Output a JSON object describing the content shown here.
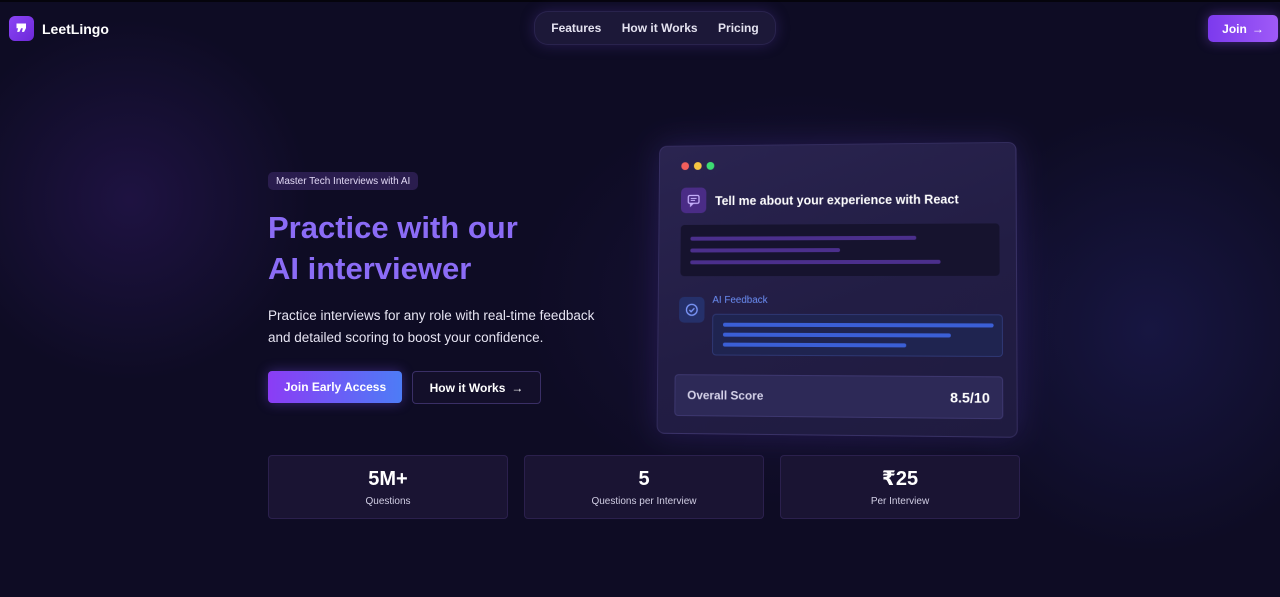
{
  "header": {
    "logo_mark": "❞",
    "logo_text": "LeetLingo",
    "nav": [
      "Features",
      "How it Works",
      "Pricing"
    ],
    "join_label": "Join",
    "join_arrow": "→"
  },
  "hero": {
    "badge": "Master Tech Interviews with AI",
    "title_line1": "Practice with our",
    "title_line2": "AI interviewer",
    "subtitle_line1": "Practice interviews for any role with real-time feedback",
    "subtitle_line2": "and detailed scoring to boost your confidence.",
    "primary_cta": "Join Early Access",
    "secondary_cta": "How it Works",
    "secondary_arrow": "→"
  },
  "card": {
    "question": "Tell me about your experience with React",
    "feedback_label": "AI Feedback",
    "score_label": "Overall Score",
    "score_value": "8.5/10"
  },
  "stats": [
    {
      "value": "5M+",
      "label": "Questions"
    },
    {
      "value": "5",
      "label": "Questions per Interview"
    },
    {
      "value": "₹25",
      "label": "Per Interview"
    }
  ],
  "colors": {
    "accent": "#8b5cf6",
    "background": "#0e0c24",
    "title": "#8b6cf6",
    "feedback": "#6c8ff7"
  }
}
